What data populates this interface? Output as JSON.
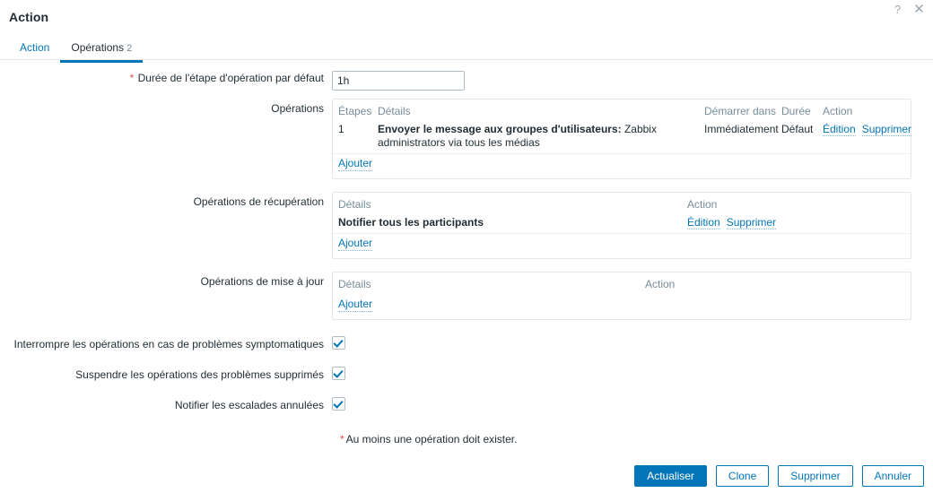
{
  "dialog": {
    "title": "Action",
    "help_icon": "?",
    "close_icon": "✕"
  },
  "tabs": [
    {
      "label": "Action",
      "count": "",
      "selected": false
    },
    {
      "label": "Opérations",
      "count": "2",
      "selected": true
    }
  ],
  "form": {
    "default_step_duration": {
      "required_mark": "*",
      "label": "Durée de l'étape d'opération par défaut",
      "value": "1h",
      "placeholder": ""
    },
    "operations": {
      "label": "Opérations",
      "headers": {
        "steps": "Étapes",
        "details": "Détails",
        "start_in": "Démarrer dans",
        "duration": "Durée",
        "action": "Action"
      },
      "rows": [
        {
          "step": "1",
          "details_strong": "Envoyer le message aux groupes d'utilisateurs:",
          "details_rest": " Zabbix administrators via tous les médias",
          "start_in": "Immédiatement",
          "duration": "Défaut",
          "edit": "Édition",
          "remove": "Supprimer"
        }
      ],
      "add_link": "Ajouter"
    },
    "recovery_operations": {
      "label": "Opérations de récupération",
      "headers": {
        "details": "Détails",
        "action": "Action"
      },
      "rows": [
        {
          "details_strong": "Notifier tous les participants",
          "edit": "Édition",
          "remove": "Supprimer"
        }
      ],
      "add_link": "Ajouter"
    },
    "update_operations": {
      "label": "Opérations de mise à jour",
      "headers": {
        "details": "Détails",
        "action": "Action"
      },
      "rows": [],
      "add_link": "Ajouter"
    },
    "checkboxes": [
      {
        "label": "Interrompre les opérations en cas de problèmes symptomatiques",
        "checked": true
      },
      {
        "label": "Suspendre les opérations des problèmes supprimés",
        "checked": true
      },
      {
        "label": "Notifier les escalades annulées",
        "checked": true
      }
    ],
    "footnote": {
      "mark": "*",
      "text": "Au moins une opération doit exister."
    }
  },
  "footer": {
    "buttons": [
      {
        "label": "Actualiser",
        "primary": true
      },
      {
        "label": "Clone",
        "primary": false
      },
      {
        "label": "Supprimer",
        "primary": false
      },
      {
        "label": "Annuler",
        "primary": false
      }
    ]
  }
}
